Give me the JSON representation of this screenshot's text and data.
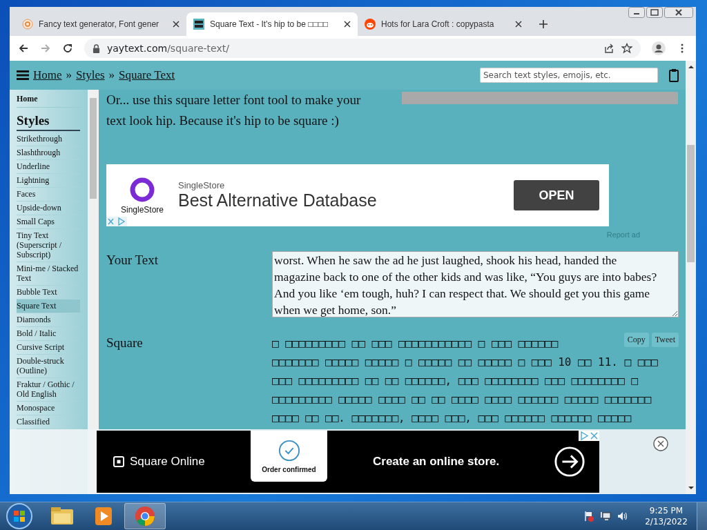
{
  "browser": {
    "tabs": [
      {
        "title": "Fancy text generator, Font gener",
        "selected": false
      },
      {
        "title": "Square Text - It's hip to be □□□□",
        "selected": true
      },
      {
        "title": "Hots for Lara Croft : copypasta",
        "selected": false
      }
    ],
    "url_host": "yaytext.com",
    "url_path": "/square-text/"
  },
  "header": {
    "breadcrumbs": [
      "Home",
      "Styles",
      "Square Text"
    ],
    "separator": "»",
    "search_placeholder": "Search text styles, emojis, etc."
  },
  "sidebar": {
    "home": "Home",
    "heading": "Styles",
    "items": [
      {
        "label": "Strikethrough",
        "selected": false
      },
      {
        "label": "Slashthrough",
        "selected": false
      },
      {
        "label": "Underline",
        "selected": false
      },
      {
        "label": "Lightning",
        "selected": false
      },
      {
        "label": "Faces",
        "selected": false
      },
      {
        "label": "Upside-down",
        "selected": false
      },
      {
        "label": "Small Caps",
        "selected": false
      },
      {
        "label": "Tiny Text (Superscript / Subscript)",
        "selected": false
      },
      {
        "label": "Mini-me / Stacked Text",
        "selected": false
      },
      {
        "label": "Bubble Text",
        "selected": false
      },
      {
        "label": "Square Text",
        "selected": true
      },
      {
        "label": "Diamonds",
        "selected": false
      },
      {
        "label": "Bold / Italic",
        "selected": false
      },
      {
        "label": "Cursive Script",
        "selected": false
      },
      {
        "label": "Double-struck (Outline)",
        "selected": false
      },
      {
        "label": "Fraktur / Gothic / Old English",
        "selected": false
      },
      {
        "label": "Monospace",
        "selected": false
      },
      {
        "label": "Classified",
        "selected": false
      }
    ]
  },
  "intro": "Or... use this square letter font tool to make your text look hip. Because it's hip to be square :)",
  "ad_banner": {
    "logo_text": "SingleStore",
    "brand": "SingleStore",
    "headline": "Best Alternative Database",
    "button": "OPEN",
    "report": "Report ad"
  },
  "input": {
    "label": "Your Text",
    "value": "worst. When he saw the ad he just laughed, shook his head, handed the magazine back to one of the other kids and was like, “You guys are into babes? And you like ‘em tough, huh? I can respect that. We should get you this game when we get home, son.”"
  },
  "output": {
    "label": "Square",
    "buttons": [
      "Copy",
      "Tweet"
    ],
    "lines": [
      "□ □□□□□□□□□ □□ □□□ □□□□□□□□□□□ □ □□□ □□□□□□",
      "□□□□□□□ □□□□□ □□□□□ □ □□□□□ □□ □□□□□ □ □□□ 10 □□ 11. □ □□□",
      "□□□ □□□□□□□□□ □□ □□ □□□□□□, □□□ □□□□□□□□ □□□ □□□□□□□□ □",
      "□□□□□□□□□ □□□□□ □□□□ □□ □□ □□□□ □□□□ □□□□□□ □□□□□ □□□□□□□",
      "□□□□ □□ □□. □□□□□□□, □□□□ □□□, □□□ □□□□□□ □□□□□□ □□□□□"
    ]
  },
  "bottom_ad": {
    "brand": "Square Online",
    "card": "Order confirmed",
    "headline": "Create an online store."
  },
  "taskbar": {
    "time": "9:25 PM",
    "date": "2/13/2022"
  }
}
